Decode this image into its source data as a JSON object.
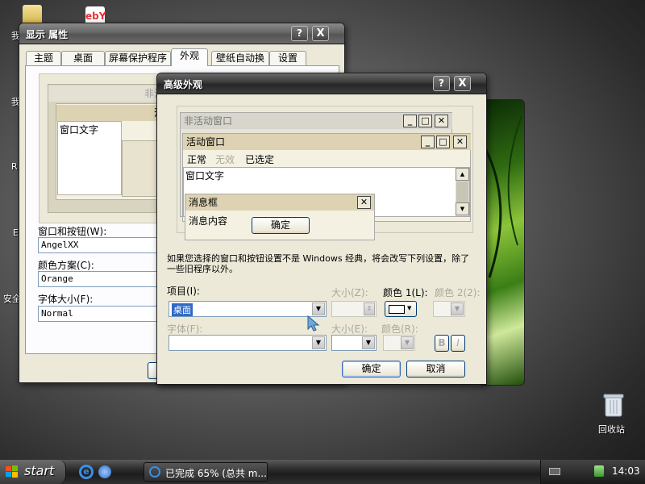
{
  "desktop": {
    "icon_labels": [
      "我",
      "我",
      "R",
      "E",
      "安全"
    ],
    "recycle_bin": "回收站"
  },
  "display_props": {
    "title": "显示 属性",
    "help_btn": "?",
    "close_btn": "X",
    "tabs": [
      "主题",
      "桌面",
      "屏幕保护程序",
      "外观",
      "壁纸自动换",
      "设置"
    ],
    "active_tab": "外观",
    "preview": {
      "inactive_title": "非活动",
      "active_title": "活动",
      "window_text": "窗口文字"
    },
    "windows_buttons_label": "窗口和按钮(W):",
    "windows_buttons_value": "AngelXX",
    "color_scheme_label": "颜色方案(C):",
    "color_scheme_value": "Orange",
    "font_size_label": "字体大小(F):",
    "font_size_value": "Normal"
  },
  "advanced": {
    "title": "高级外观",
    "help_btn": "?",
    "close_btn": "X",
    "preview": {
      "inactive_window": "非活动窗口",
      "active_window": "活动窗口",
      "menu": [
        "正常",
        "无效",
        "已选定"
      ],
      "window_text": "窗口文字",
      "msgbox_title": "消息框",
      "msgbox_text": "消息内容",
      "msgbox_ok": "确定"
    },
    "notice": "如果您选择的窗口和按钮设置不是 Windows 经典，将会改写下列设置，除了一些旧程序以外。",
    "item_label": "项目(I):",
    "item_value": "桌面",
    "size_label": "大小(Z):",
    "color1_label": "颜色 1(L):",
    "color2_label": "颜色 2(2):",
    "font_label": "字体(F):",
    "font_size_label": "大小(E):",
    "font_color_label": "颜色(R):",
    "bold_btn": "B",
    "italic_btn": "I",
    "ok": "确定",
    "cancel": "取消",
    "color1_value": "#ffffff"
  },
  "taskbar": {
    "start": "start",
    "task_label": "已完成 65% (总共 m...",
    "clock": "14:03"
  }
}
